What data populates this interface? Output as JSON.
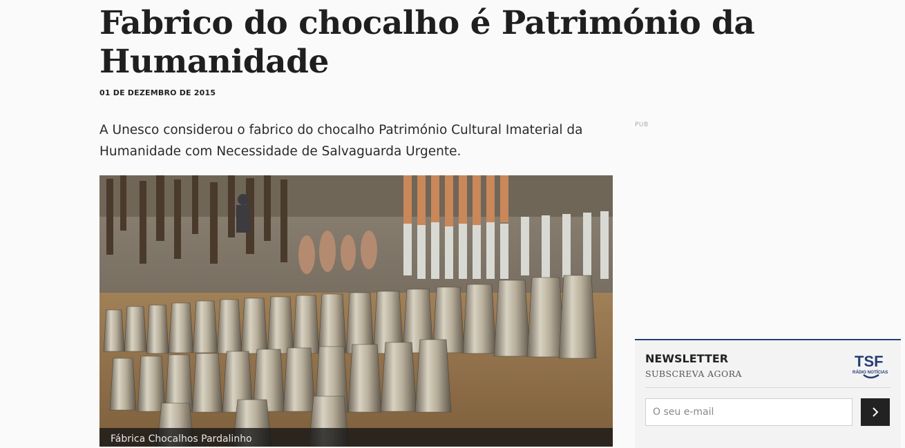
{
  "article": {
    "title": "Fabrico do chocalho é Património da Humanidade",
    "date": "01 DE DEZEMBRO DE 2015",
    "lead": "A Unesco considerou o fabrico do chocalho Património Cultural Imaterial da Humanidade com Necessidade de Salvaguarda Urgente.",
    "image_caption": "Fábrica Chocalhos Pardalinho"
  },
  "ad": {
    "label": "PUB"
  },
  "newsletter": {
    "title": "NEWSLETTER",
    "subtitle": "SUBSCREVA AGORA",
    "logo_text": "TSF",
    "logo_subtext": "RÁDIO NOTÍCIAS",
    "email_placeholder": "O seu e-mail",
    "submit_icon": "chevron-right-icon"
  },
  "colors": {
    "accent": "#263c77",
    "button": "#222222"
  }
}
